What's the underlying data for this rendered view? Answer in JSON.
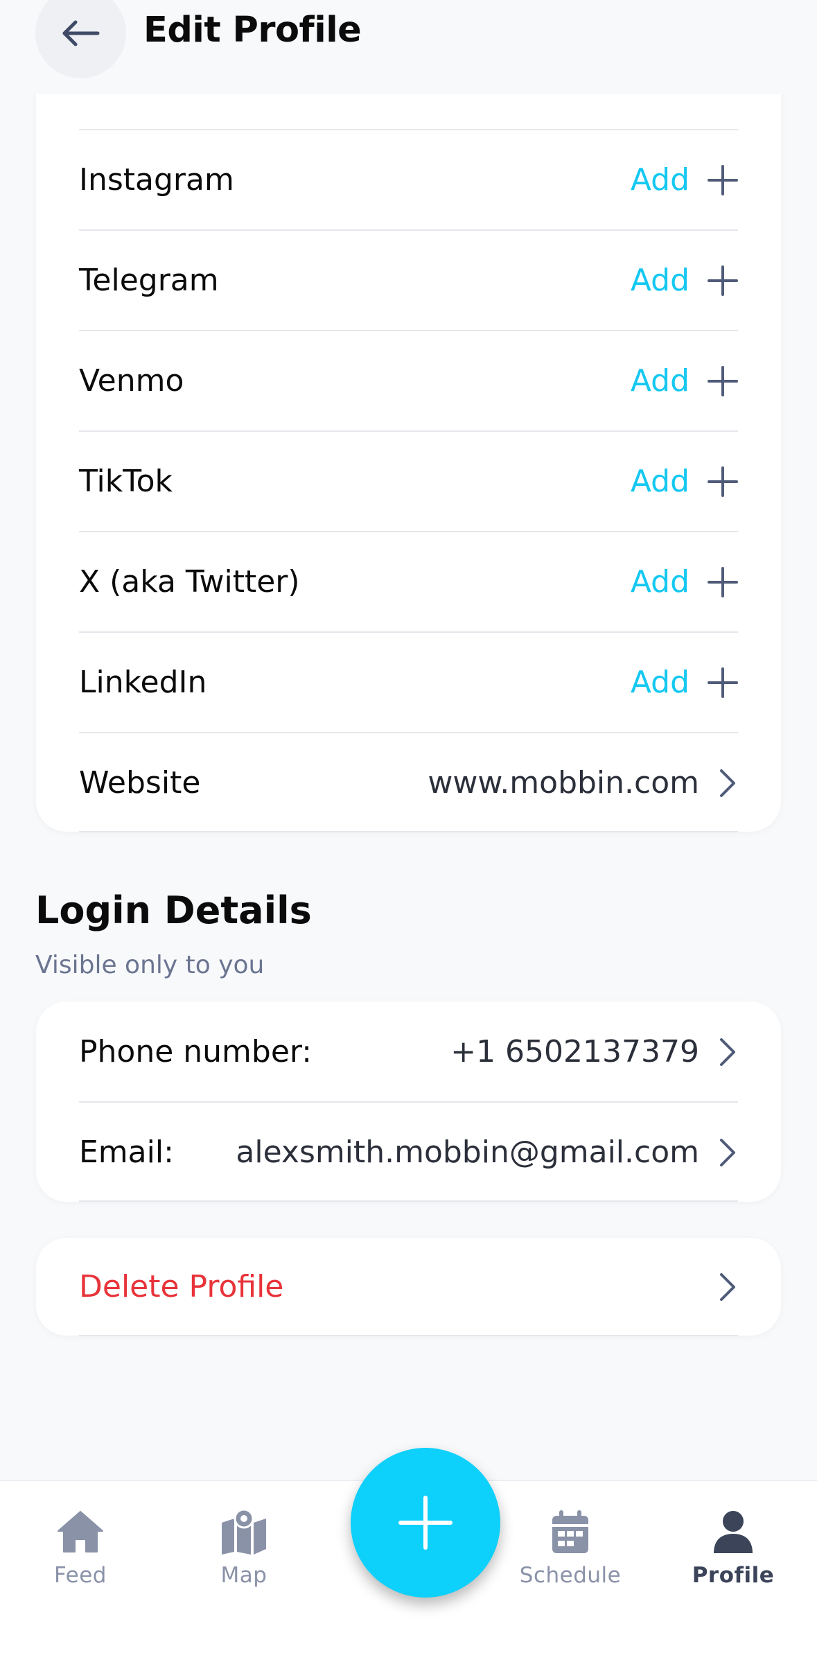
{
  "header": {
    "title": "Edit Profile"
  },
  "social": {
    "add_label": "Add",
    "items": [
      {
        "label": "Instagram"
      },
      {
        "label": "Telegram"
      },
      {
        "label": "Venmo"
      },
      {
        "label": "TikTok"
      },
      {
        "label": "X (aka Twitter)"
      },
      {
        "label": "LinkedIn"
      }
    ],
    "website": {
      "label": "Website",
      "value": "www.mobbin.com"
    }
  },
  "login": {
    "title": "Login Details",
    "subtitle": "Visible only to you",
    "phone": {
      "label": "Phone number:",
      "value": "+1 6502137379"
    },
    "email": {
      "label": "Email:",
      "value": "alexsmith.mobbin@gmail.com"
    }
  },
  "danger": {
    "delete_label": "Delete Profile"
  },
  "bottom_nav": {
    "feed": "Feed",
    "map": "Map",
    "schedule": "Schedule",
    "profile": "Profile",
    "active": "Profile"
  },
  "colors": {
    "accent": "#14c8f1",
    "danger": "#e8333a",
    "icon": "#4f5b78"
  }
}
